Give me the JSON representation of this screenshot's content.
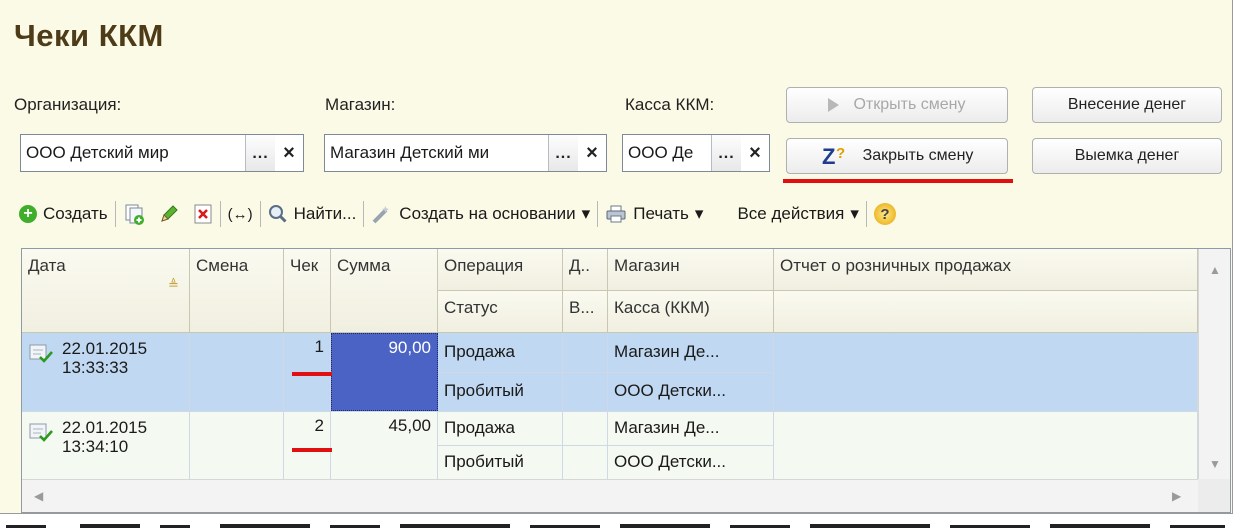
{
  "title": "Чеки ККМ",
  "labels": {
    "org": "Организация:",
    "shop": "Магазин:",
    "kassa": "Касса ККМ:"
  },
  "fields": {
    "org": "ООО Детский мир",
    "shop": "Магазин Детский ми",
    "kassa": "ООО Де",
    "select_symbol": "...",
    "clear_symbol": "×"
  },
  "buttons": {
    "open_shift": "Открыть смену",
    "close_shift": "Закрыть смену",
    "deposit": "Внесение денег",
    "withdraw": "Выемка денег"
  },
  "toolbar": {
    "create": "Создать",
    "find": "Найти...",
    "create_based": "Создать на основании",
    "print": "Печать",
    "all_actions": "Все действия",
    "link_symbol": "(↔)",
    "dropdown": "▾",
    "help_symbol": "?"
  },
  "columns": {
    "date": "Дата",
    "shift": "Смена",
    "check": "Чек",
    "sum": "Сумма",
    "operation": "Операция",
    "d": "Д..",
    "shop": "Магазин",
    "report": "Отчет о розничных продажах",
    "status": "Статус",
    "v": "В...",
    "kassa": "Касса (ККМ)"
  },
  "rows": [
    {
      "date": "22.01.2015",
      "time": "13:33:33",
      "check": "1",
      "sum": "90,00",
      "operation": "Продажа",
      "status": "Пробитый",
      "shop": "Магазин Де...",
      "kassa": "ООО Детски..."
    },
    {
      "date": "22.01.2015",
      "time": "13:34:10",
      "check": "2",
      "sum": "45,00",
      "operation": "Продажа",
      "status": "Пробитый",
      "shop": "Магазин Де...",
      "kassa": "ООО Детски..."
    }
  ],
  "colors": {
    "selected_row": "#c0d8f2",
    "selected_cell": "#4b63c4",
    "accent_red": "#e01010",
    "title": "#4e3b17"
  }
}
